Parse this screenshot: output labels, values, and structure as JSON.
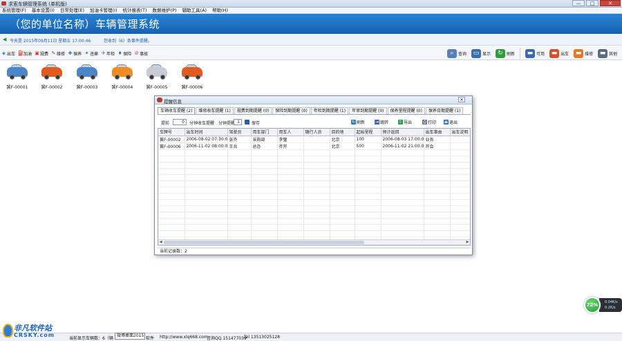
{
  "app": {
    "title": "求索车辆管理系统 (单机版)",
    "banner": "（您的单位名称）车辆管理系统"
  },
  "window_buttons": {
    "minimize": "—",
    "maximize": "□",
    "close": "✕"
  },
  "menu": [
    "系统管理(F)",
    "基本设置(I)",
    "日常处理(E)",
    "加油卡管理(I)",
    "统计报表(T)",
    "数据维护(P)",
    "辅助工具(A)",
    "帮助(H)"
  ],
  "info": {
    "date": "今天是 2015年09月11日 星期五 17:00:46",
    "reminder": "您收到（6）条事件提醒。"
  },
  "toolbar_left": [
    {
      "label": "出车",
      "icon": "car-out-icon"
    },
    {
      "label": "加油",
      "icon": "fuel-icon"
    },
    {
      "label": "规费",
      "icon": "fee-icon"
    },
    {
      "label": "维修",
      "icon": "repair-icon"
    },
    {
      "label": "保养",
      "icon": "maintain-icon"
    },
    {
      "label": "违章",
      "icon": "violation-icon"
    },
    {
      "label": "年检",
      "icon": "inspection-icon"
    },
    {
      "label": "保险",
      "icon": "insurance-icon"
    },
    {
      "label": "事故",
      "icon": "accident-icon"
    }
  ],
  "toolbar_right": [
    {
      "label": "查询",
      "icon": "search-icon",
      "color": "#5a7fb8"
    },
    {
      "label": "显示",
      "icon": "display-icon",
      "color": "#3b6db3"
    },
    {
      "label": "刷新",
      "icon": "refresh-icon",
      "color": "#2f9a3a"
    },
    {
      "label": "可用",
      "icon": "available-car-icon",
      "color": "#3a67b0"
    },
    {
      "label": "出车",
      "icon": "out-car-icon",
      "color": "#d2502a"
    },
    {
      "label": "维修",
      "icon": "repair-car-icon",
      "color": "#e07a2a"
    },
    {
      "label": "其他",
      "icon": "other-car-icon",
      "color": "#5b6b80"
    }
  ],
  "cars": [
    {
      "plate": "冀F-00001",
      "color": "#4a86c8"
    },
    {
      "plate": "冀F-00002",
      "color": "#e25a1f"
    },
    {
      "plate": "冀F-00003",
      "color": "#4a86c8"
    },
    {
      "plate": "冀F-00004",
      "color": "#ef8d22"
    },
    {
      "plate": "冀F-00005",
      "color": "#c9ccd2"
    },
    {
      "plate": "冀F-00006",
      "color": "#e25a1f"
    }
  ],
  "dialog": {
    "title": "提醒信息",
    "close": "✕",
    "tabs": [
      "车辆收车提醒 (2)",
      "维修收车提醒 (1)",
      "规费到期提醒 (0)",
      "保险到期提醒 (0)",
      "年检到期提醒 (1)",
      "年审到期提醒 (0)",
      "保养里程提醒 (0)",
      "保养日期提醒 (1)"
    ],
    "toolbar": {
      "advance_label": "提前",
      "advance_value": "0",
      "advance_suffix": "分钟收车提醒",
      "interval_label": "分钟提醒前",
      "interval_value": "1",
      "save": "保存",
      "refresh": "刷新",
      "jump": "跳转",
      "export": "导出",
      "print": "打印",
      "exit": "退出"
    },
    "table": {
      "headers": [
        "车牌号",
        "出车时间",
        "驾驶员",
        "用车部门",
        "用车人",
        "随行人员",
        "目的地",
        "起始里程",
        "预计返回",
        "出车事由",
        "出车说明"
      ],
      "rows": [
        [
          "冀F-00002",
          "2006-08-02 07:30:00",
          "张齐",
          "采购部",
          "李璧",
          "",
          "北京",
          "100",
          "2006-08-03 17:00:00",
          "业务",
          ""
        ],
        [
          "冀F-00006",
          "2006-11-02 08:00:00",
          "王兵",
          "总办",
          "齐开",
          "",
          "北京",
          "500",
          "2006-11-02 21:00:00",
          "开会",
          ""
        ]
      ]
    },
    "status": "当前记录数：2"
  },
  "statusbar": {
    "cars": "当前显示车辆数：6（辆",
    "tooltip": "微博桌面2015",
    "software": "软件",
    "url": "http://www.xlq668.com",
    "qq": "咨询QQ 151477039",
    "tel": "Tel 13513025128"
  },
  "watermark": {
    "cn": "非凡软件站",
    "en": "CRSKY.com"
  },
  "netmon": {
    "percent": "72%",
    "up": "0.04K/s",
    "down": "0.2K/s"
  }
}
